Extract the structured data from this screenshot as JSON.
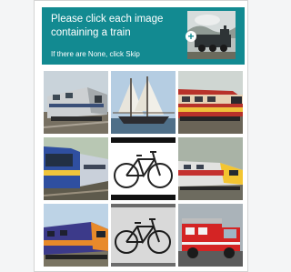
{
  "challenge": {
    "prompt": "Please click each image containing a train",
    "subprompt": "If there are None, click Skip",
    "plus_symbol": "+",
    "accent_color": "#128a91"
  },
  "grid": {
    "tiles": [
      {
        "subject": "train"
      },
      {
        "subject": "sailboat"
      },
      {
        "subject": "train"
      },
      {
        "subject": "train"
      },
      {
        "subject": "bicycle"
      },
      {
        "subject": "train"
      },
      {
        "subject": "train"
      },
      {
        "subject": "bicycle"
      },
      {
        "subject": "fire-truck"
      }
    ]
  }
}
